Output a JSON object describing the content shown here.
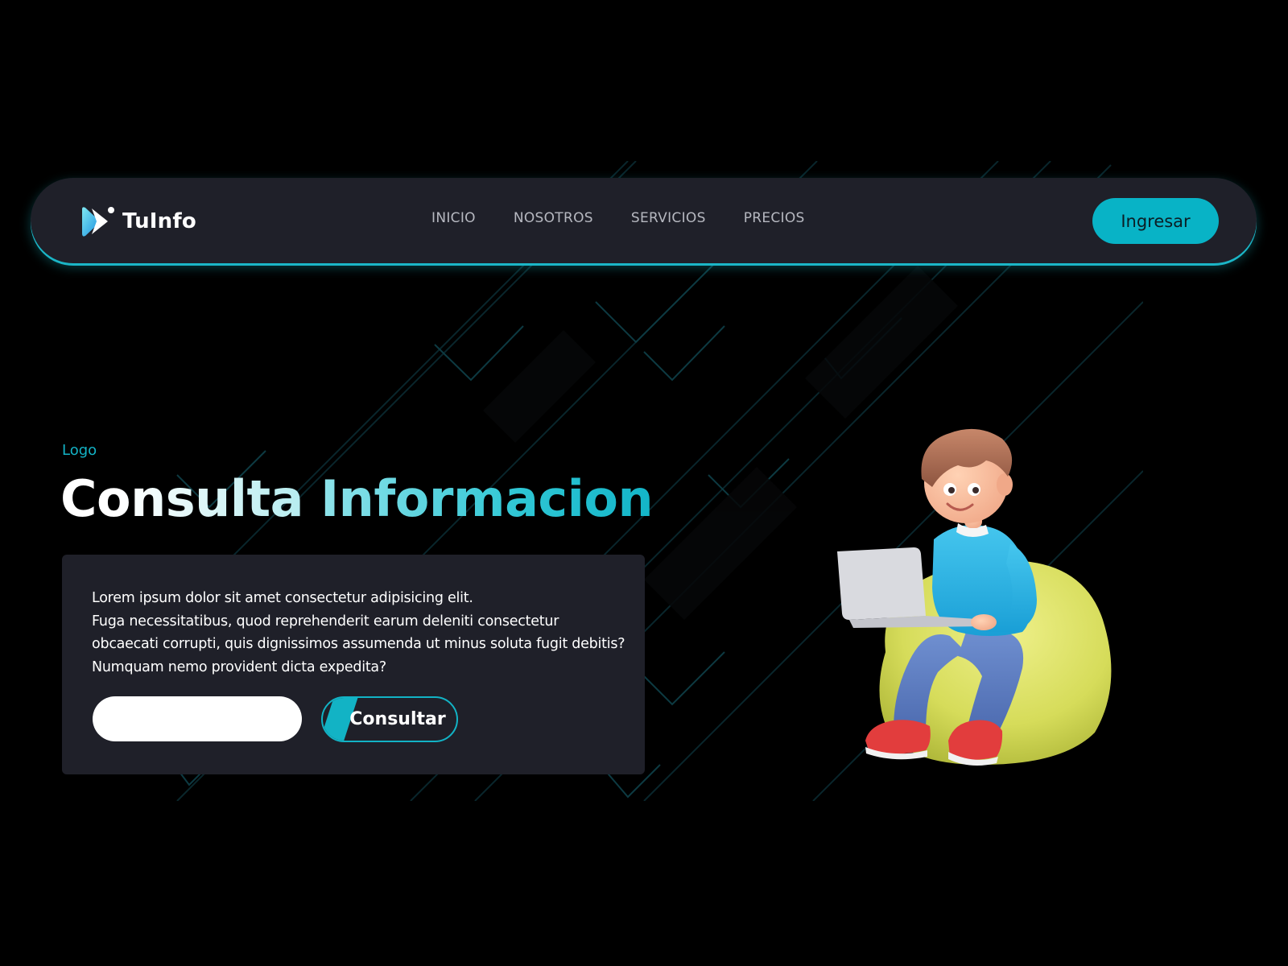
{
  "brand": {
    "name": "TuInfo",
    "logo_icon": "play-chevron-logo-icon"
  },
  "nav": {
    "links": [
      {
        "label": "INICIO"
      },
      {
        "label": "NOSOTROS"
      },
      {
        "label": "SERVICIOS"
      },
      {
        "label": "PRECIOS"
      }
    ],
    "login_label": "Ingresar"
  },
  "hero": {
    "kicker": "Logo",
    "title_part1": "Consulta",
    "title_part2": "Informacion",
    "description_lines": [
      "Lorem ipsum dolor sit amet consectetur adipisicing elit.",
      "Fuga necessitatibus, quod reprehenderit earum deleniti consectetur",
      "obcaecati corrupti, quis dignissimos assumenda ut minus soluta fugit debitis?",
      "Numquam nemo provident dicta expedita?"
    ],
    "input_value": "",
    "input_placeholder": "",
    "button_label": "Consultar"
  },
  "illustration": {
    "icon": "boy-with-laptop-on-beanbag-illustration"
  },
  "colors": {
    "background": "#000000",
    "surface": "#1f2029",
    "accent": "#12b3c5",
    "nav_text": "#b6b8c0",
    "text": "#ffffff"
  }
}
